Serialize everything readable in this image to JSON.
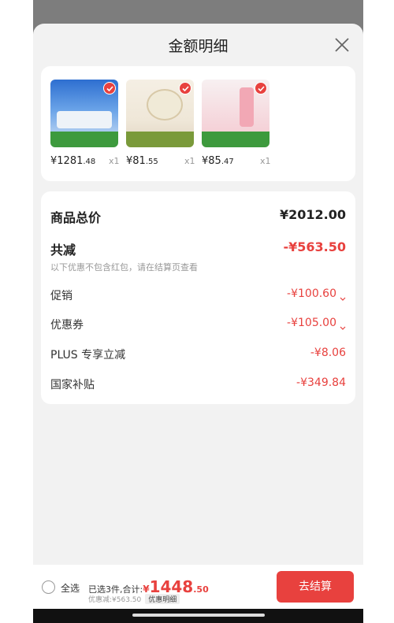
{
  "title": "金额明细",
  "products": [
    {
      "price_int": "¥1281",
      "price_dec": ".48",
      "qty": "x1",
      "colors": [
        "#2e6fd0",
        "#d9e6f5"
      ]
    },
    {
      "price_int": "¥81",
      "price_dec": ".55",
      "qty": "x1",
      "colors": [
        "#efe7d8",
        "#7a9a3a"
      ]
    },
    {
      "price_int": "¥85",
      "price_dec": ".47",
      "qty": "x1",
      "colors": [
        "#f4c7cf",
        "#f7f0f1"
      ]
    }
  ],
  "breakdown": {
    "total_label": "商品总价",
    "total_value": "¥2012.00",
    "reduce_label": "共减",
    "reduce_value": "-¥563.50",
    "note": "以下优惠不包含红包，请在结算页查看",
    "items": [
      {
        "label": "促销",
        "value": "-¥100.60"
      },
      {
        "label": "优惠券",
        "value": "-¥105.00"
      },
      {
        "label": "PLUS 专享立减",
        "value": "-¥8.06"
      },
      {
        "label": "国家补贴",
        "value": "-¥349.84"
      }
    ]
  },
  "bottom_bar": {
    "select_all": "全选",
    "summary_prefix": "已选3件,合计:",
    "total_yen": "¥",
    "total_int": "1448",
    "total_dec": ".50",
    "discount_text": "优惠减:¥563.50",
    "detail_button": "优惠明细",
    "checkout_button": "去结算"
  },
  "colors": {
    "accent": "#e8413e",
    "sheet_bg": "#f2f2f2"
  }
}
